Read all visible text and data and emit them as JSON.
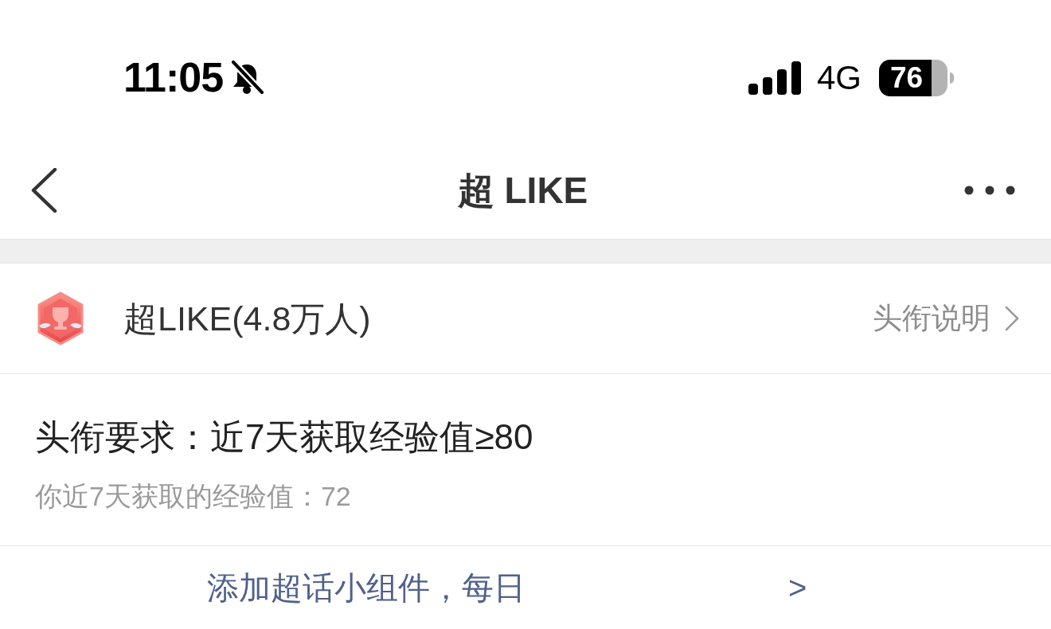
{
  "status_bar": {
    "time": "11:05",
    "network": "4G",
    "battery": "76"
  },
  "nav_bar": {
    "title": "超 LIKE"
  },
  "title_row": {
    "name": "超LIKE(4.8万人)",
    "link": "头衔说明"
  },
  "requirement": {
    "text": "头衔要求：近7天获取经验值≥80",
    "current": "你近7天获取的经验值：72"
  },
  "widget_banner": {
    "text": "添加超话小组件，每日",
    "arrow": ">"
  }
}
